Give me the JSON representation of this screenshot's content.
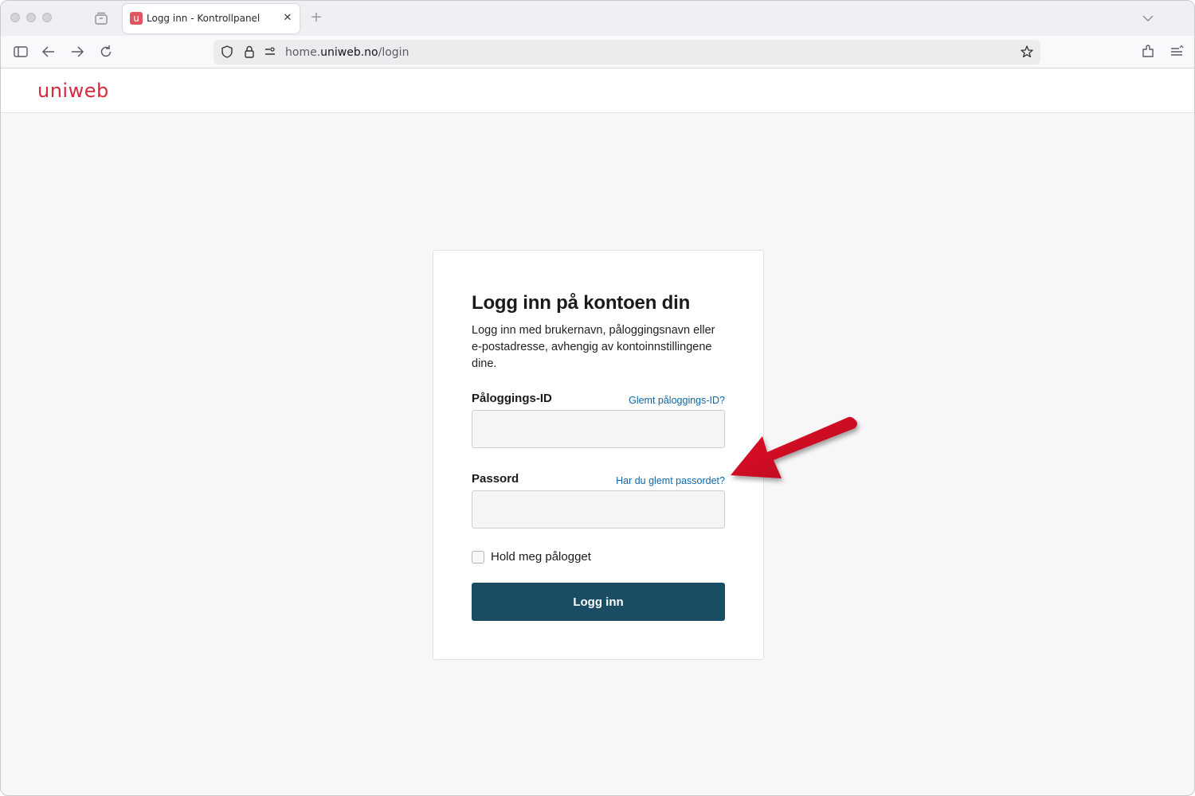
{
  "browser": {
    "tab": {
      "favicon_letter": "u",
      "title": "Logg inn - Kontrollpanel"
    },
    "address": {
      "prefix": "home.",
      "host": "uniweb.no",
      "path": "/login"
    },
    "icons": {
      "close": "✕",
      "new_tab": "+"
    }
  },
  "site": {
    "logo_text": "uniweb",
    "brand_color": "#d6293e"
  },
  "login": {
    "title": "Logg inn på kontoen din",
    "intro": "Logg inn med brukernavn, påloggingsnavn eller e-postadresse, avhengig av kontoinnstillingene dine.",
    "username_label": "Påloggings-ID",
    "forgot_username": "Glemt påloggings-ID?",
    "username_value": "",
    "password_label": "Passord",
    "forgot_password": "Har du glemt passordet?",
    "password_value": "",
    "remember_label": "Hold meg pålogget",
    "remember_checked": false,
    "submit_label": "Logg inn",
    "button_color": "#1a4d63",
    "link_color": "#1066a8"
  },
  "annotation": {
    "arrow_color": "#d0021b"
  }
}
